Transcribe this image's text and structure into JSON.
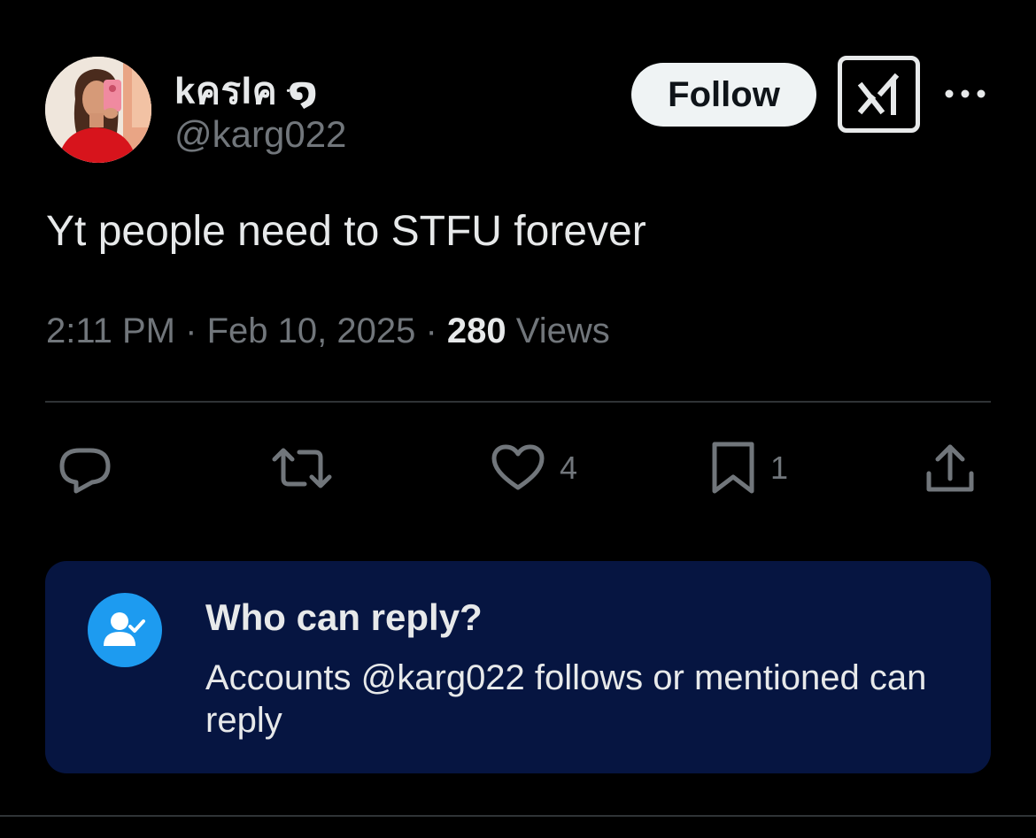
{
  "author": {
    "display_name": "kครlค ּ໑",
    "handle": "@karg022",
    "avatar_icon": "profile-photo"
  },
  "header": {
    "follow_label": "Follow",
    "grok_icon": "grok-icon",
    "more_icon": "more-icon"
  },
  "tweet": {
    "text": "Yt people need to STFU forever",
    "time": "2:11 PM",
    "separator": "·",
    "date": "Feb 10, 2025",
    "views_count": "280",
    "views_label": "Views"
  },
  "actions": {
    "reply_icon": "reply-icon",
    "retweet_icon": "retweet-icon",
    "like_icon": "heart-icon",
    "like_count": "4",
    "bookmark_icon": "bookmark-icon",
    "bookmark_count": "1",
    "share_icon": "share-icon"
  },
  "reply_settings": {
    "icon": "user-check-icon",
    "title": "Who can reply?",
    "description": "Accounts @karg022 follows or mentioned can reply"
  },
  "colors": {
    "background": "#000000",
    "text_primary": "#e7e9ea",
    "text_secondary": "#71767b",
    "accent": "#1d9bf0",
    "reply_box": "#061541",
    "divider": "#2f3336"
  }
}
